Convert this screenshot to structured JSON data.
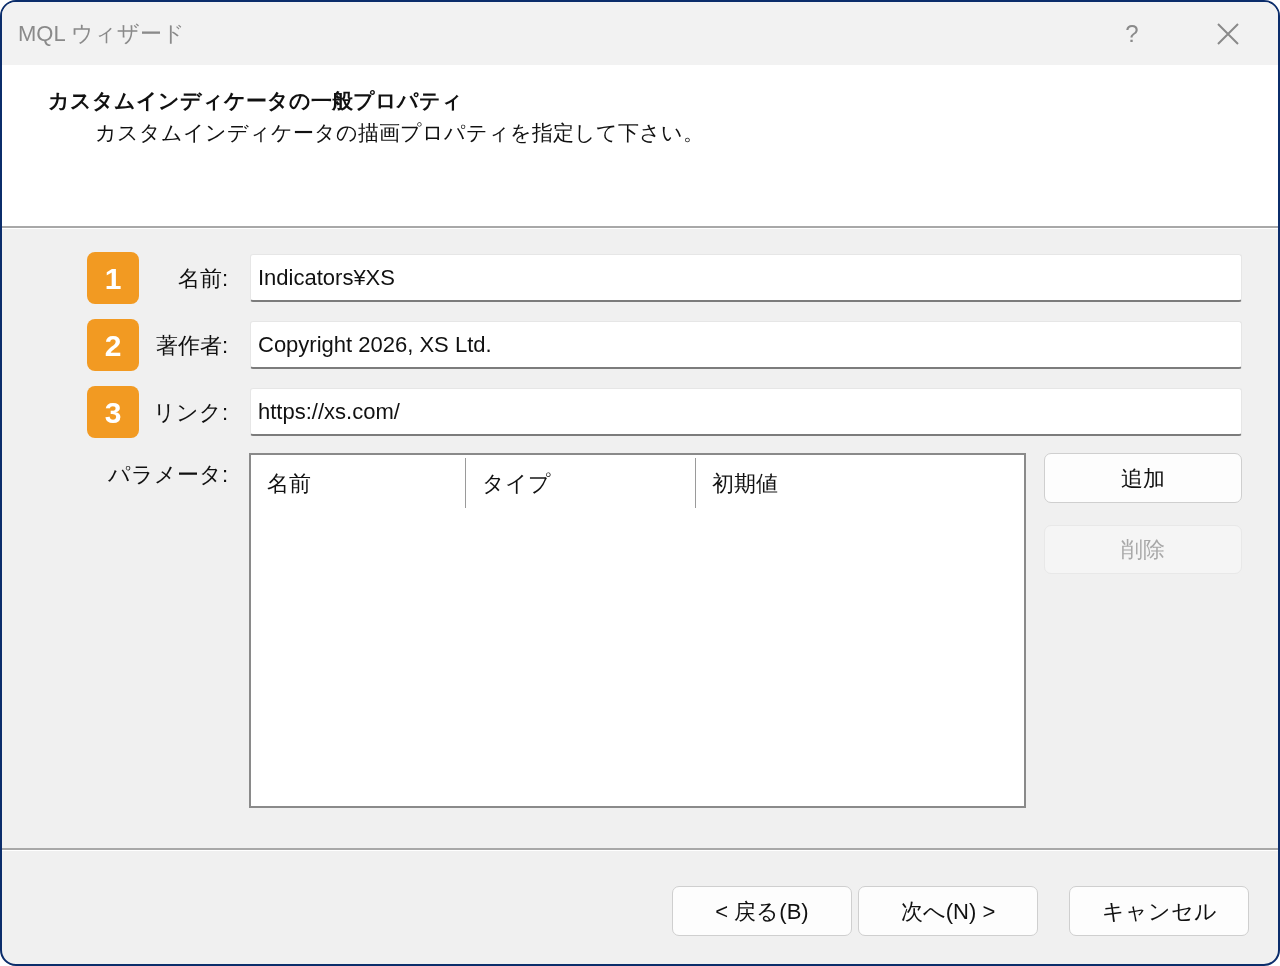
{
  "window": {
    "title": "MQL ウィザード",
    "help_button": "?"
  },
  "header": {
    "title": "カスタムインディケータの一般プロパティ",
    "subtitle": "カスタムインディケータの描画プロパティを指定して下さい。"
  },
  "fields": [
    {
      "badge": "1",
      "label": "名前:",
      "value": "Indicators¥XS"
    },
    {
      "badge": "2",
      "label": "著作者:",
      "value": "Copyright 2026, XS Ltd."
    },
    {
      "badge": "3",
      "label": "リンク:",
      "value": "https://xs.com/"
    }
  ],
  "parameters": {
    "label": "パラメータ:",
    "columns": [
      "名前",
      "タイプ",
      "初期値"
    ],
    "buttons": [
      {
        "label": "追加",
        "disabled": false
      },
      {
        "label": "削除",
        "disabled": true
      }
    ]
  },
  "footer_buttons": [
    {
      "label": "< 戻る(B)"
    },
    {
      "label": "次へ(N) >"
    },
    {
      "label": "キャンセル"
    }
  ]
}
